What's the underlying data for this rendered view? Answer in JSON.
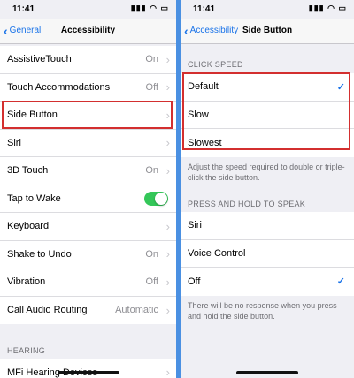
{
  "left": {
    "status": {
      "time": "11:41",
      "icons": "▮▮▮ ◠ ▭"
    },
    "nav": {
      "back": "General",
      "title": "Accessibility"
    },
    "rows": [
      {
        "label": "AssistiveTouch",
        "value": "On"
      },
      {
        "label": "Touch Accommodations",
        "value": "Off"
      },
      {
        "label": "Side Button",
        "value": ""
      },
      {
        "label": "Siri",
        "value": ""
      },
      {
        "label": "3D Touch",
        "value": "On"
      },
      {
        "label": "Tap to Wake",
        "value": ""
      },
      {
        "label": "Keyboard",
        "value": ""
      },
      {
        "label": "Shake to Undo",
        "value": "On"
      },
      {
        "label": "Vibration",
        "value": "Off"
      },
      {
        "label": "Call Audio Routing",
        "value": "Automatic"
      }
    ],
    "tap_to_wake_on": true,
    "hearing_header": "HEARING",
    "hearing_rows": [
      {
        "label": "MFi Hearing Devices"
      }
    ]
  },
  "right": {
    "status": {
      "time": "11:41",
      "icons": "▮▮▮ ◠ ▭"
    },
    "nav": {
      "back": "Accessibility",
      "title": "Side Button"
    },
    "click_speed_header": "CLICK SPEED",
    "click_speed": [
      {
        "label": "Default",
        "selected": true
      },
      {
        "label": "Slow",
        "selected": false
      },
      {
        "label": "Slowest",
        "selected": false
      }
    ],
    "click_speed_footer": "Adjust the speed required to double or triple-click the side button.",
    "press_hold_header": "PRESS AND HOLD TO SPEAK",
    "press_hold": [
      {
        "label": "Siri",
        "selected": false
      },
      {
        "label": "Voice Control",
        "selected": false
      },
      {
        "label": "Off",
        "selected": true
      }
    ],
    "press_hold_footer": "There will be no response when you press and hold the side button."
  },
  "colors": {
    "accent": "#1a73e8",
    "highlight": "#d32f2f",
    "toggle": "#34c759",
    "divider": "#4a90e2"
  },
  "icons": {
    "back": "chevron-left-icon",
    "disclosure": "chevron-right-icon",
    "check": "checkmark-icon"
  }
}
